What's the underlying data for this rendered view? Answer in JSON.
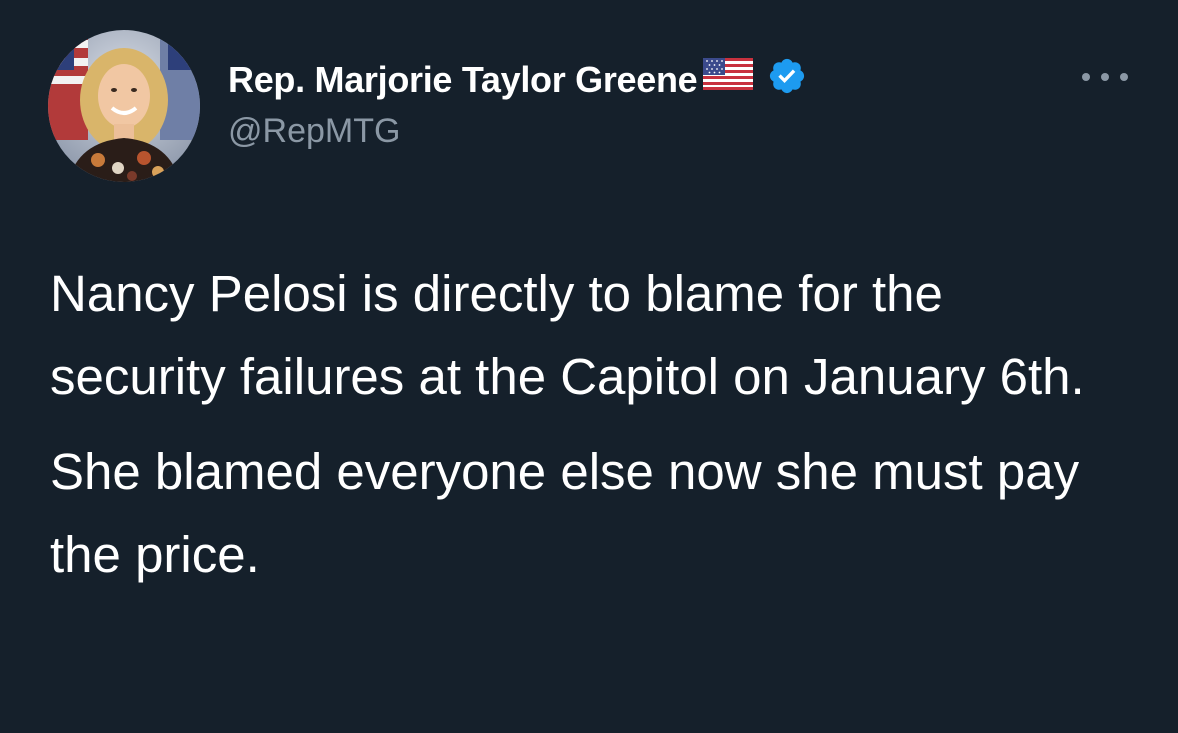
{
  "author": {
    "display_name": "Rep. Marjorie Taylor Greene",
    "handle": "@RepMTG",
    "flag_icon": "us-flag-emoji",
    "verified_icon": "verified-badge-icon",
    "verified_color": "#1d9bf0"
  },
  "tweet": {
    "paragraphs": [
      "Nancy Pelosi is directly to blame for the security failures at the Capitol on January 6th.",
      "She blamed everyone else now she must pay the price."
    ]
  },
  "menu": {
    "icon": "more-options-icon"
  },
  "colors": {
    "background": "#15202b",
    "text_primary": "#ffffff",
    "text_secondary": "#8b98a5"
  }
}
